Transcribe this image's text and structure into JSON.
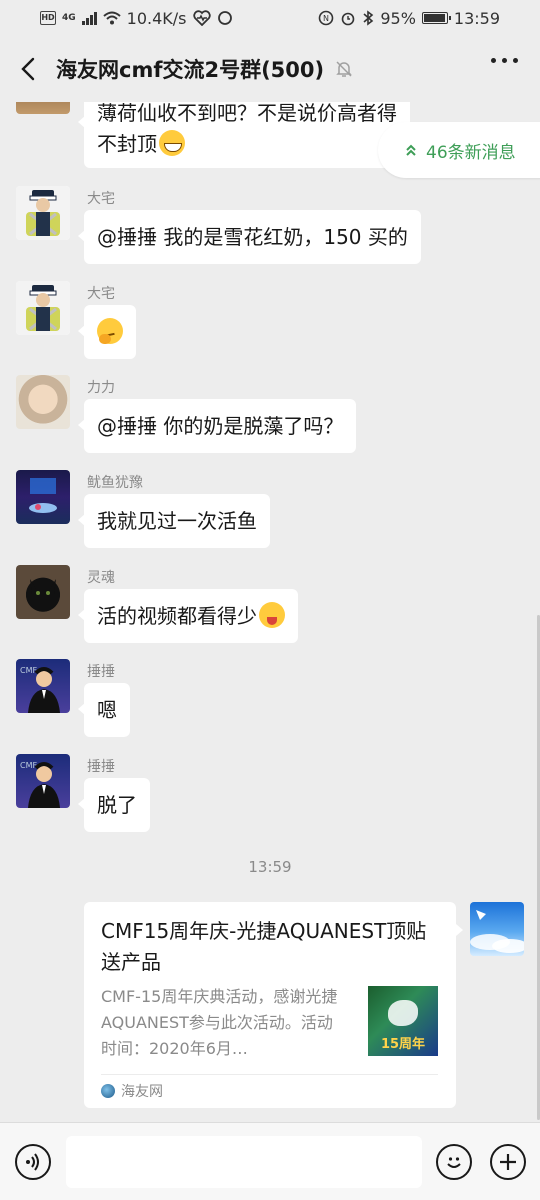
{
  "status": {
    "net_speed": "10.4K/s",
    "network": "4G",
    "battery": "95%",
    "battery_level": 0.95,
    "time": "13:59"
  },
  "header": {
    "title": "海友网cmf交流2号群(500)"
  },
  "new_messages": {
    "label": "46条新消息"
  },
  "messages": [
    {
      "nick": "",
      "text_line1": "薄荷仙收不到吧？不是说价高者得",
      "text_line2": "不封顶",
      "emoji": "grin"
    },
    {
      "nick": "大宅",
      "text": "@捶捶  我的是雪花红奶，150 买的",
      "emoji": ""
    },
    {
      "nick": "大宅",
      "text": "",
      "emoji": "think"
    },
    {
      "nick": "力力",
      "text": "@捶捶 你的奶是脱藻了吗？",
      "emoji": ""
    },
    {
      "nick": "鱿鱼犹豫",
      "text": "我就见过一次活鱼",
      "emoji": ""
    },
    {
      "nick": "灵魂",
      "text": "活的视频都看得少",
      "emoji": "drool"
    },
    {
      "nick": "捶捶",
      "text": "嗯",
      "emoji": ""
    },
    {
      "nick": "捶捶",
      "text": "脱了",
      "emoji": ""
    }
  ],
  "timestamp": "13:59",
  "link_card": {
    "title": "CMF15周年庆-光捷AQUANEST顶贴送产品",
    "description": "CMF-15周年庆典活动，感谢光捷AQUANEST参与此次活动。活动时间：2020年6月…",
    "thumb_text": "15周年",
    "source": "海友网"
  },
  "colors": {
    "background": "#ededed",
    "bubble": "#ffffff",
    "new_msg_accent": "#3e9e57",
    "meta_text": "#8a8a8a"
  },
  "icons": {
    "back": "chevron-left-icon",
    "mute": "bell-off-icon",
    "more": "more-dots-icon",
    "voice": "voice-icon",
    "emoji": "emoji-face-icon",
    "add": "plus-icon",
    "new_msg": "double-chevron-up-icon"
  }
}
